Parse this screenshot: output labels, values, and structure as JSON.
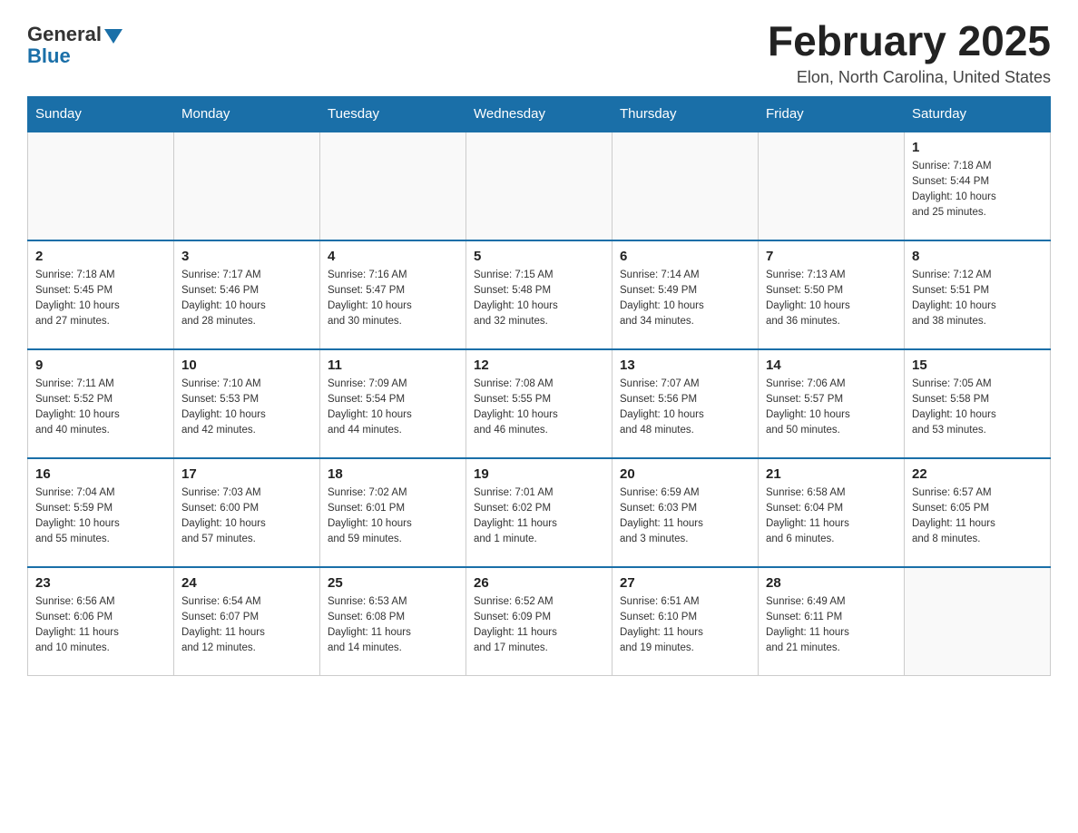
{
  "logo": {
    "general": "General",
    "blue": "Blue"
  },
  "header": {
    "title": "February 2025",
    "location": "Elon, North Carolina, United States"
  },
  "days_of_week": [
    "Sunday",
    "Monday",
    "Tuesday",
    "Wednesday",
    "Thursday",
    "Friday",
    "Saturday"
  ],
  "weeks": [
    [
      {
        "day": "",
        "info": ""
      },
      {
        "day": "",
        "info": ""
      },
      {
        "day": "",
        "info": ""
      },
      {
        "day": "",
        "info": ""
      },
      {
        "day": "",
        "info": ""
      },
      {
        "day": "",
        "info": ""
      },
      {
        "day": "1",
        "info": "Sunrise: 7:18 AM\nSunset: 5:44 PM\nDaylight: 10 hours\nand 25 minutes."
      }
    ],
    [
      {
        "day": "2",
        "info": "Sunrise: 7:18 AM\nSunset: 5:45 PM\nDaylight: 10 hours\nand 27 minutes."
      },
      {
        "day": "3",
        "info": "Sunrise: 7:17 AM\nSunset: 5:46 PM\nDaylight: 10 hours\nand 28 minutes."
      },
      {
        "day": "4",
        "info": "Sunrise: 7:16 AM\nSunset: 5:47 PM\nDaylight: 10 hours\nand 30 minutes."
      },
      {
        "day": "5",
        "info": "Sunrise: 7:15 AM\nSunset: 5:48 PM\nDaylight: 10 hours\nand 32 minutes."
      },
      {
        "day": "6",
        "info": "Sunrise: 7:14 AM\nSunset: 5:49 PM\nDaylight: 10 hours\nand 34 minutes."
      },
      {
        "day": "7",
        "info": "Sunrise: 7:13 AM\nSunset: 5:50 PM\nDaylight: 10 hours\nand 36 minutes."
      },
      {
        "day": "8",
        "info": "Sunrise: 7:12 AM\nSunset: 5:51 PM\nDaylight: 10 hours\nand 38 minutes."
      }
    ],
    [
      {
        "day": "9",
        "info": "Sunrise: 7:11 AM\nSunset: 5:52 PM\nDaylight: 10 hours\nand 40 minutes."
      },
      {
        "day": "10",
        "info": "Sunrise: 7:10 AM\nSunset: 5:53 PM\nDaylight: 10 hours\nand 42 minutes."
      },
      {
        "day": "11",
        "info": "Sunrise: 7:09 AM\nSunset: 5:54 PM\nDaylight: 10 hours\nand 44 minutes."
      },
      {
        "day": "12",
        "info": "Sunrise: 7:08 AM\nSunset: 5:55 PM\nDaylight: 10 hours\nand 46 minutes."
      },
      {
        "day": "13",
        "info": "Sunrise: 7:07 AM\nSunset: 5:56 PM\nDaylight: 10 hours\nand 48 minutes."
      },
      {
        "day": "14",
        "info": "Sunrise: 7:06 AM\nSunset: 5:57 PM\nDaylight: 10 hours\nand 50 minutes."
      },
      {
        "day": "15",
        "info": "Sunrise: 7:05 AM\nSunset: 5:58 PM\nDaylight: 10 hours\nand 53 minutes."
      }
    ],
    [
      {
        "day": "16",
        "info": "Sunrise: 7:04 AM\nSunset: 5:59 PM\nDaylight: 10 hours\nand 55 minutes."
      },
      {
        "day": "17",
        "info": "Sunrise: 7:03 AM\nSunset: 6:00 PM\nDaylight: 10 hours\nand 57 minutes."
      },
      {
        "day": "18",
        "info": "Sunrise: 7:02 AM\nSunset: 6:01 PM\nDaylight: 10 hours\nand 59 minutes."
      },
      {
        "day": "19",
        "info": "Sunrise: 7:01 AM\nSunset: 6:02 PM\nDaylight: 11 hours\nand 1 minute."
      },
      {
        "day": "20",
        "info": "Sunrise: 6:59 AM\nSunset: 6:03 PM\nDaylight: 11 hours\nand 3 minutes."
      },
      {
        "day": "21",
        "info": "Sunrise: 6:58 AM\nSunset: 6:04 PM\nDaylight: 11 hours\nand 6 minutes."
      },
      {
        "day": "22",
        "info": "Sunrise: 6:57 AM\nSunset: 6:05 PM\nDaylight: 11 hours\nand 8 minutes."
      }
    ],
    [
      {
        "day": "23",
        "info": "Sunrise: 6:56 AM\nSunset: 6:06 PM\nDaylight: 11 hours\nand 10 minutes."
      },
      {
        "day": "24",
        "info": "Sunrise: 6:54 AM\nSunset: 6:07 PM\nDaylight: 11 hours\nand 12 minutes."
      },
      {
        "day": "25",
        "info": "Sunrise: 6:53 AM\nSunset: 6:08 PM\nDaylight: 11 hours\nand 14 minutes."
      },
      {
        "day": "26",
        "info": "Sunrise: 6:52 AM\nSunset: 6:09 PM\nDaylight: 11 hours\nand 17 minutes."
      },
      {
        "day": "27",
        "info": "Sunrise: 6:51 AM\nSunset: 6:10 PM\nDaylight: 11 hours\nand 19 minutes."
      },
      {
        "day": "28",
        "info": "Sunrise: 6:49 AM\nSunset: 6:11 PM\nDaylight: 11 hours\nand 21 minutes."
      },
      {
        "day": "",
        "info": ""
      }
    ]
  ]
}
